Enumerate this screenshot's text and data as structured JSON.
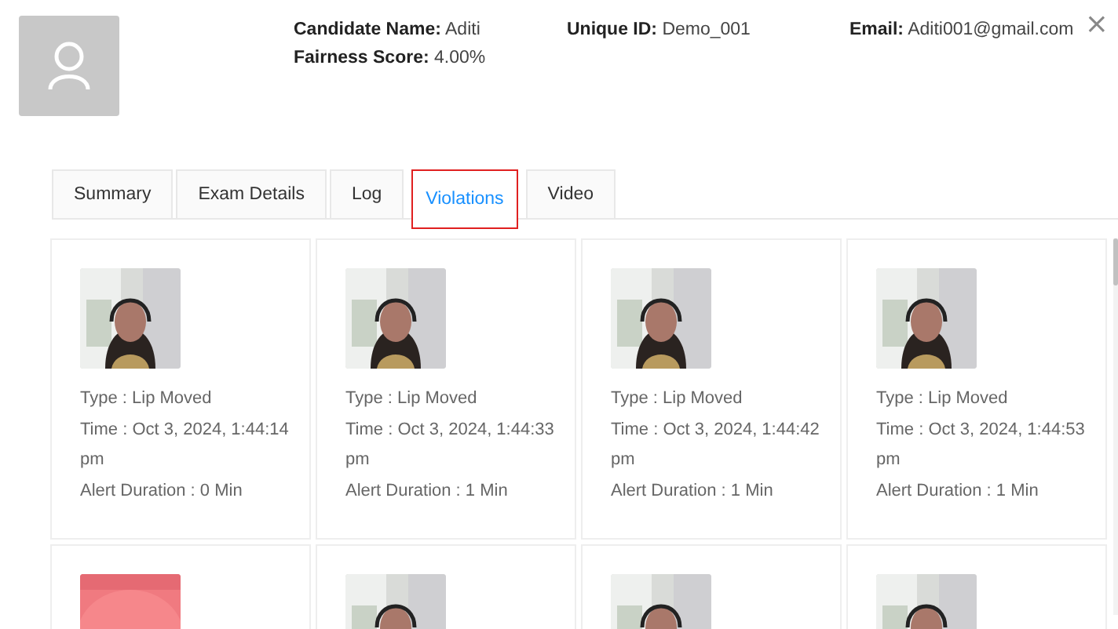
{
  "candidate": {
    "name_label": "Candidate Name:",
    "name": "Aditi",
    "score_label": "Fairness Score:",
    "score": "4.00%",
    "id_label": "Unique ID:",
    "id": "Demo_001",
    "email_label": "Email:",
    "email": "Aditi001@gmail.com"
  },
  "close": "×",
  "tabs": [
    {
      "label": "Summary",
      "selected": false
    },
    {
      "label": "Exam Details",
      "selected": false
    },
    {
      "label": "Log",
      "selected": false
    },
    {
      "label": "Violations",
      "selected": true
    },
    {
      "label": "Video",
      "selected": false
    }
  ],
  "violations": [
    {
      "kind": "picture",
      "type": "Type : Lip Moved",
      "time": "Time : Oct 3, 2024, 1:44:14 pm",
      "duration": "Alert Duration : 0 Min"
    },
    {
      "kind": "picture",
      "type": "Type : Lip Moved",
      "time": "Time : Oct 3, 2024, 1:44:33 pm",
      "duration": "Alert Duration : 1 Min"
    },
    {
      "kind": "picture",
      "type": "Type : Lip Moved",
      "time": "Time : Oct 3, 2024, 1:44:42 pm",
      "duration": "Alert Duration : 1 Min"
    },
    {
      "kind": "picture",
      "type": "Type : Lip Moved",
      "time": "Time : Oct 3, 2024, 1:44:53 pm",
      "duration": "Alert Duration : 1 Min"
    },
    {
      "kind": "blank_frame"
    },
    {
      "kind": "picture"
    },
    {
      "kind": "picture"
    },
    {
      "kind": "picture"
    }
  ]
}
